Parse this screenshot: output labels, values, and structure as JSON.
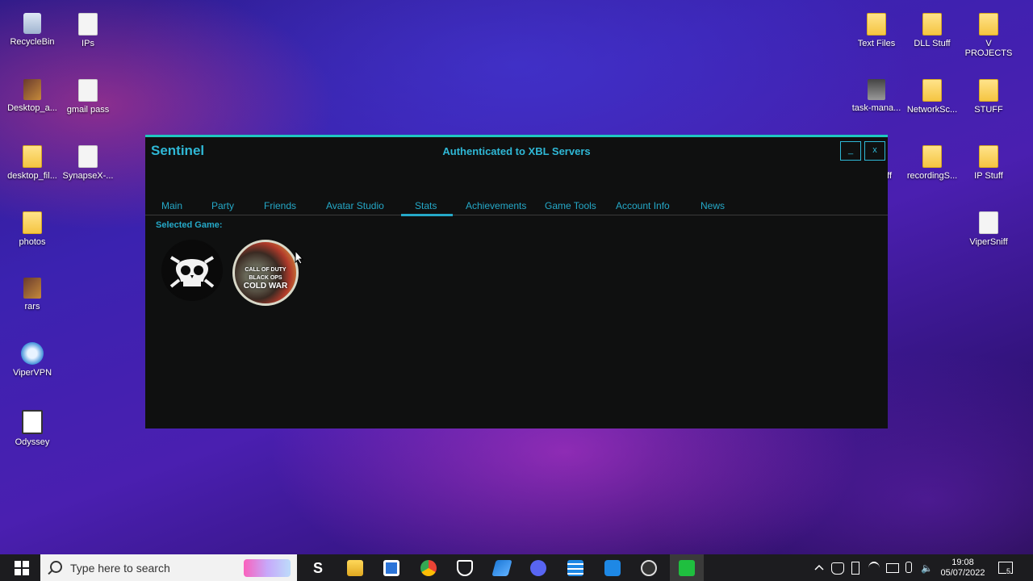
{
  "desktop": {
    "left_icons": [
      {
        "label": "RecycleBin",
        "icon": "recycle-bin-icon"
      },
      {
        "label": "IPs",
        "icon": "file-icon"
      },
      {
        "label": "Desktop_a...",
        "icon": "archive-icon"
      },
      {
        "label": "gmail pass",
        "icon": "file-icon"
      },
      {
        "label": "desktop_fil...",
        "icon": "folder-icon"
      },
      {
        "label": "SynapseX-...",
        "icon": "file-icon"
      },
      {
        "label": "photos",
        "icon": "folder-icon"
      },
      {
        "label": "rars",
        "icon": "archive-icon"
      },
      {
        "label": "ViperVPN",
        "icon": "vpn-icon"
      },
      {
        "label": "Odyssey",
        "icon": "app-icon"
      }
    ],
    "right_icons": [
      {
        "label": "Text Files",
        "icon": "folder-icon"
      },
      {
        "label": "DLL Stuff",
        "icon": "folder-icon"
      },
      {
        "label": "V PROJECTS",
        "icon": "folder-icon"
      },
      {
        "label": "task-mana...",
        "icon": "app-icon"
      },
      {
        "label": "NetworkSc...",
        "icon": "folder-icon"
      },
      {
        "label": "STUFF",
        "icon": "folder-icon"
      },
      {
        "label": "tuff",
        "icon": "folder-icon"
      },
      {
        "label": "recordingS...",
        "icon": "folder-icon"
      },
      {
        "label": "IP Stuff",
        "icon": "folder-icon"
      },
      {
        "label": "ViperSniff",
        "icon": "app-icon"
      }
    ]
  },
  "window": {
    "title": "Sentinel",
    "status": "Authenticated to XBL Servers",
    "minimize_label": "_",
    "close_label": "x",
    "tabs": [
      "Main",
      "Party",
      "Friends",
      "Avatar Studio",
      "Stats",
      "Achievements",
      "Game Tools",
      "Account Info",
      "News"
    ],
    "active_tab": "Stats",
    "selected_game_label": "Selected Game:",
    "games": [
      {
        "name": "sea-of-thieves",
        "icon": "skull-icon"
      },
      {
        "name": "call-of-duty-cold-war",
        "line1": "CALL OF DUTY",
        "line2": "BLACK OPS",
        "line3": "COLD WAR"
      }
    ]
  },
  "taskbar": {
    "search_placeholder": "Type here to search",
    "time": "19:08",
    "date": "05/07/2022",
    "notification_count": "5"
  },
  "colors": {
    "accent": "#25a9c8",
    "window_bg": "#0f1010",
    "window_border": "#1fc7c0"
  }
}
